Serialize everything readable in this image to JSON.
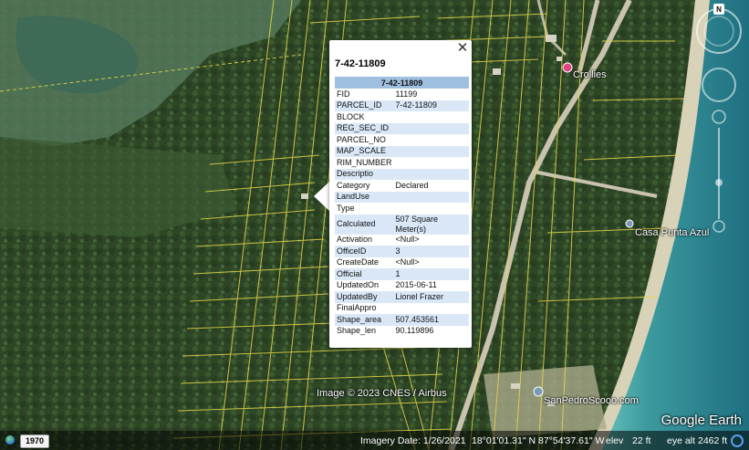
{
  "map": {
    "places": [
      {
        "name": "Crollies"
      },
      {
        "name": "Casa Punta Azul"
      },
      {
        "name": "SanPedroScooo.com"
      }
    ],
    "copyright": "Image © 2023 CNES / Airbus",
    "brand": "Google Earth",
    "compass_letter": "N",
    "historical_year": "1970"
  },
  "status_bar": {
    "imagery_date": "Imagery Date: 1/26/2021",
    "latitude": "18°01'01.31\" N",
    "longitude": "87°54'37.61\" W",
    "elev_label": "elev",
    "elev_value": "22 ft",
    "eye_alt_label": "eye alt",
    "eye_alt_value": "2462 ft"
  },
  "popup": {
    "title": "7-42-11809",
    "table_header": "7-42-11809",
    "close_symbol": "✕",
    "rows": [
      {
        "key": "FID",
        "value": "11199"
      },
      {
        "key": "PARCEL_ID",
        "value": "7-42-11809"
      },
      {
        "key": "BLOCK",
        "value": ""
      },
      {
        "key": "REG_SEC_ID",
        "value": ""
      },
      {
        "key": "PARCEL_NO",
        "value": ""
      },
      {
        "key": "MAP_SCALE",
        "value": ""
      },
      {
        "key": "RIM_NUMBER",
        "value": ""
      },
      {
        "key": "Descriptio",
        "value": ""
      },
      {
        "key": "Category",
        "value": "Declared"
      },
      {
        "key": "LandUse",
        "value": ""
      },
      {
        "key": "Type",
        "value": ""
      },
      {
        "key": "Calculated",
        "value": "507 Square Meter(s)"
      },
      {
        "key": "Activation",
        "value": "<Null>"
      },
      {
        "key": "OfficeID",
        "value": "3"
      },
      {
        "key": "CreateDate",
        "value": "<Null>"
      },
      {
        "key": "Official",
        "value": "1"
      },
      {
        "key": "UpdatedOn",
        "value": "2015-06-11"
      },
      {
        "key": "UpdatedBy",
        "value": "Lionel Frazer"
      },
      {
        "key": "FinalAppro",
        "value": ""
      },
      {
        "key": "Shape_area",
        "value": "507.453561"
      },
      {
        "key": "Shape_len",
        "value": "90.119896"
      }
    ]
  },
  "colors": {
    "parcel_line": "#e8d84a",
    "sea": "#3e9a9a",
    "vegetation": "#2f4a25",
    "table_header": "#9fbfe0",
    "table_alt_row": "#d9e7f7",
    "pin_red": "#e0457b"
  }
}
